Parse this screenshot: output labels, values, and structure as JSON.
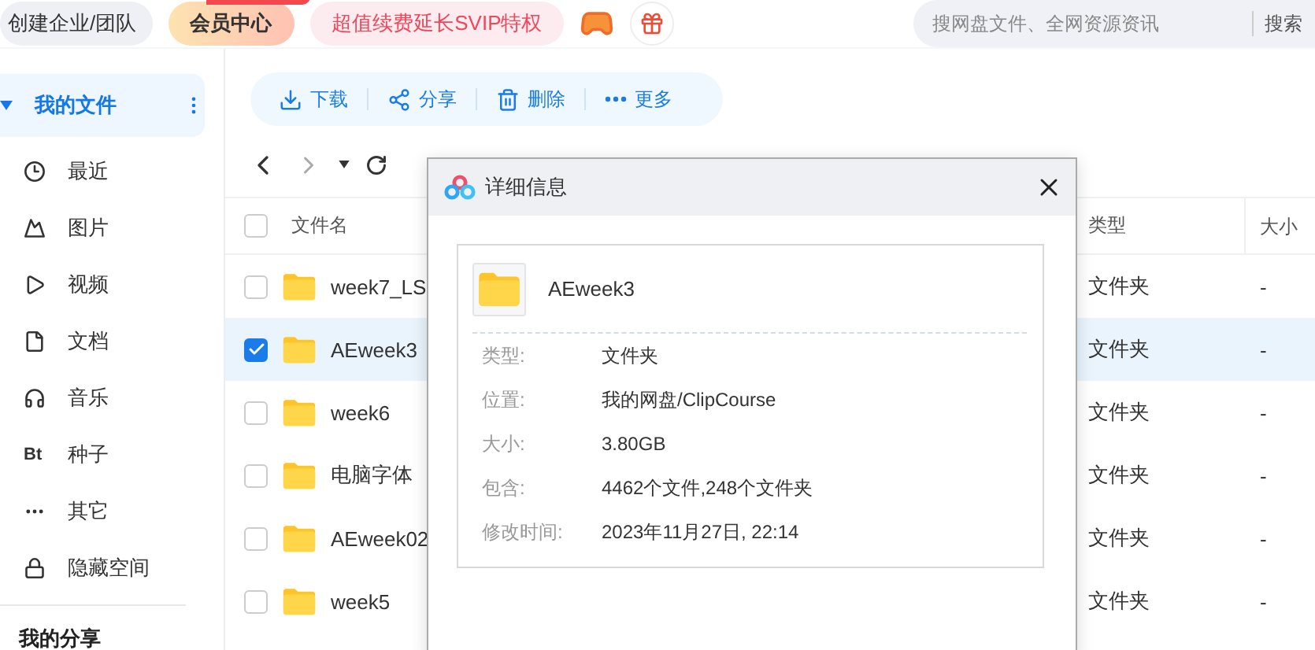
{
  "top_bar": {
    "buttons": [
      {
        "label": "创建企业/团队",
        "kind": "plain"
      },
      {
        "label": "会员中心",
        "kind": "vip"
      },
      {
        "label": "超值续费延长SVIP特权",
        "kind": "promo"
      }
    ],
    "search": {
      "placeholder": "搜网盘文件、全网资源资讯",
      "button": "搜索"
    }
  },
  "sidebar": {
    "items": [
      {
        "label": "我的文件",
        "selected": true
      },
      {
        "label": "最近",
        "selected": false
      },
      {
        "label": "图片",
        "selected": false
      },
      {
        "label": "视频",
        "selected": false
      },
      {
        "label": "文档",
        "selected": false
      },
      {
        "label": "音乐",
        "selected": false
      },
      {
        "label": "种子",
        "glyph": "Bt",
        "selected": false
      },
      {
        "label": "其它",
        "selected": false
      },
      {
        "label": "隐藏空间",
        "selected": false
      }
    ],
    "section": "我的分享"
  },
  "toolbar": {
    "actions": [
      "下载",
      "分享",
      "删除",
      "更多"
    ]
  },
  "table": {
    "columns": [
      "文件名",
      "类型",
      "大小"
    ],
    "all_checked": false,
    "rows": [
      {
        "name": "week7_LS",
        "type": "文件夹",
        "size": "-",
        "selected": false
      },
      {
        "name": "AEweek3",
        "type": "文件夹",
        "size": "-",
        "selected": true
      },
      {
        "name": "week6",
        "type": "文件夹",
        "size": "-",
        "selected": false
      },
      {
        "name": "电脑字体",
        "type": "文件夹",
        "size": "-",
        "selected": false
      },
      {
        "name": "AEweek02",
        "type": "文件夹",
        "size": "-",
        "selected": false
      },
      {
        "name": "week5",
        "type": "文件夹",
        "size": "-",
        "selected": false
      }
    ]
  },
  "dialog": {
    "title": "详细信息",
    "name": "AEweek3",
    "details": [
      {
        "label": "类型:",
        "value": "文件夹"
      },
      {
        "label": "位置:",
        "value": "我的网盘/ClipCourse"
      },
      {
        "label": "大小:",
        "value": "3.80GB"
      },
      {
        "label": "包含:",
        "value": "4462个文件,248个文件夹"
      },
      {
        "label": "修改时间:",
        "value": "2023年11月27日, 22:14"
      }
    ]
  }
}
